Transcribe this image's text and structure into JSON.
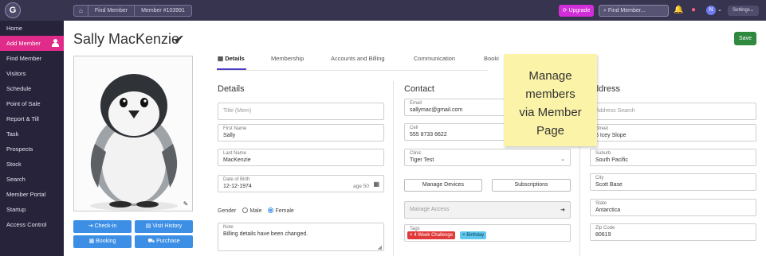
{
  "topbar": {
    "logo_letter": "G",
    "home_glyph": "⌂",
    "crumbs": [
      "Find Member",
      "Member #103991"
    ],
    "upgrade_label": "Upgrade",
    "search_placeholder": "Find Member...",
    "avatar_letter": "N",
    "settings_label": "Settings"
  },
  "sidebar": {
    "items": [
      {
        "label": "Home"
      },
      {
        "label": "Add Member",
        "active": true
      },
      {
        "label": "Find Member"
      },
      {
        "label": "Visitors"
      },
      {
        "label": "Schedule"
      },
      {
        "label": "Point of Sale"
      },
      {
        "label": "Report & Till"
      },
      {
        "label": "Task"
      },
      {
        "label": "Prospects"
      },
      {
        "label": "Stock"
      },
      {
        "label": "Search"
      },
      {
        "label": "Member Portal"
      },
      {
        "label": "Startup"
      },
      {
        "label": "Access Control"
      }
    ]
  },
  "header": {
    "member_name": "Sally MacKenzie",
    "check_glyph": "✔",
    "save_label": "Save"
  },
  "actions": {
    "checkin": "Check-in",
    "visit_history": "Visit History",
    "booking": "Booking",
    "purchase": "Purchase"
  },
  "tabs": [
    "Details",
    "Membership",
    "Accounts and Billing",
    "Communication",
    "Booki"
  ],
  "details": {
    "title": "Details",
    "title_placeholder": "Title (Mem)",
    "first_name_label": "First Name",
    "first_name": "Sally",
    "last_name_label": "Last Name",
    "last_name": "MacKenzie",
    "dob_label": "Date of Birth",
    "dob": "12-12-1974",
    "age": "age 50",
    "gender_label": "Gender",
    "gender_male": "Male",
    "gender_female": "Female",
    "gender_selected": "Female",
    "note_label": "Note",
    "note": "Billing details have been changed."
  },
  "contact": {
    "title": "Contact",
    "email_label": "Email",
    "email": "sallymac@gmail.com",
    "cell_label": "Cell",
    "cell": "555 8733 6622",
    "clinic_label": "Clinic",
    "clinic": "Tiger Test",
    "manage_devices": "Manage Devices",
    "subscriptions": "Subscriptions",
    "manage_access": "Manage Access",
    "tags_label": "Tags",
    "tags": [
      "4 Week Challenge",
      "Birthday"
    ]
  },
  "address": {
    "title": "ddress",
    "search_placeholder": "Address Search",
    "street_label": "Street",
    "street": "6 Icey Slope",
    "suburb_label": "Suburb",
    "suburb": "South Pacific",
    "city_label": "City",
    "city": "Scott Base",
    "state_label": "State",
    "state": "Antarctica",
    "zip_label": "Zip Code",
    "zip": "80619"
  },
  "sticky_note": [
    "Manage",
    "members",
    "via Member",
    "Page"
  ]
}
